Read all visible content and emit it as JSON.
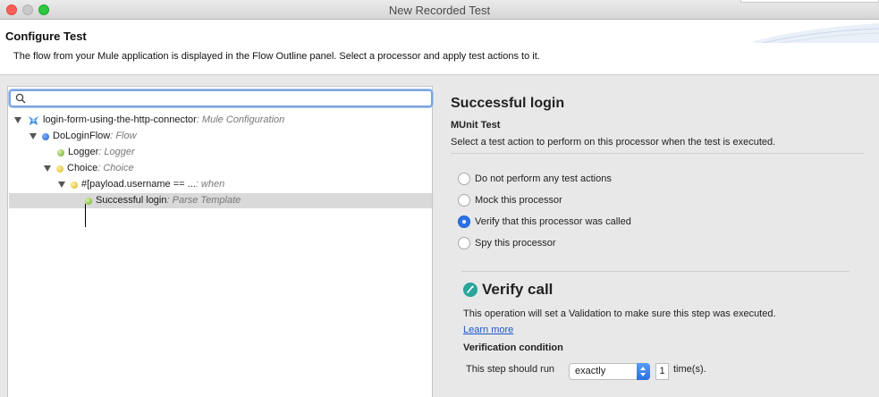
{
  "window": {
    "title": "New Recorded Test"
  },
  "header": {
    "title": "Configure Test",
    "description": "The flow from your Mule application is displayed in the Flow Outline panel. Select a processor and apply test actions to it."
  },
  "search": {
    "value": "",
    "placeholder": ""
  },
  "tree": {
    "config": {
      "name": "login-form-using-the-http-connector",
      "type": " : Mule Configuration"
    },
    "flow": {
      "name": "DoLoginFlow",
      "type": " : Flow"
    },
    "logger": {
      "name": "Logger",
      "type": " : Logger"
    },
    "choice": {
      "name": "Choice",
      "type": " : Choice"
    },
    "when": {
      "name": "#[payload.username == ...",
      "type": " : when"
    },
    "selected": {
      "name": "Successful login",
      "type": " : Parse Template"
    }
  },
  "details": {
    "title": "Successful login",
    "subtitle": "MUnit Test",
    "description": "Select a test action to perform on this processor when the test is executed.",
    "options": [
      {
        "label": "Do not perform any test actions",
        "checked": false
      },
      {
        "label": "Mock this processor",
        "checked": false
      },
      {
        "label": "Verify that this processor was called",
        "checked": true
      },
      {
        "label": "Spy this processor",
        "checked": false
      }
    ]
  },
  "verify": {
    "title": "Verify call",
    "description": "This operation will set a Validation to make sure this step was executed.",
    "link": "Learn more",
    "condition_label": "Verification condition",
    "run_label": "This step should run",
    "mode": "exactly",
    "count": "1",
    "unit": "time(s)."
  },
  "colors": {
    "accent": "#2b73e8",
    "verify_icon": "#2aa59a",
    "link": "#1b56c9"
  }
}
